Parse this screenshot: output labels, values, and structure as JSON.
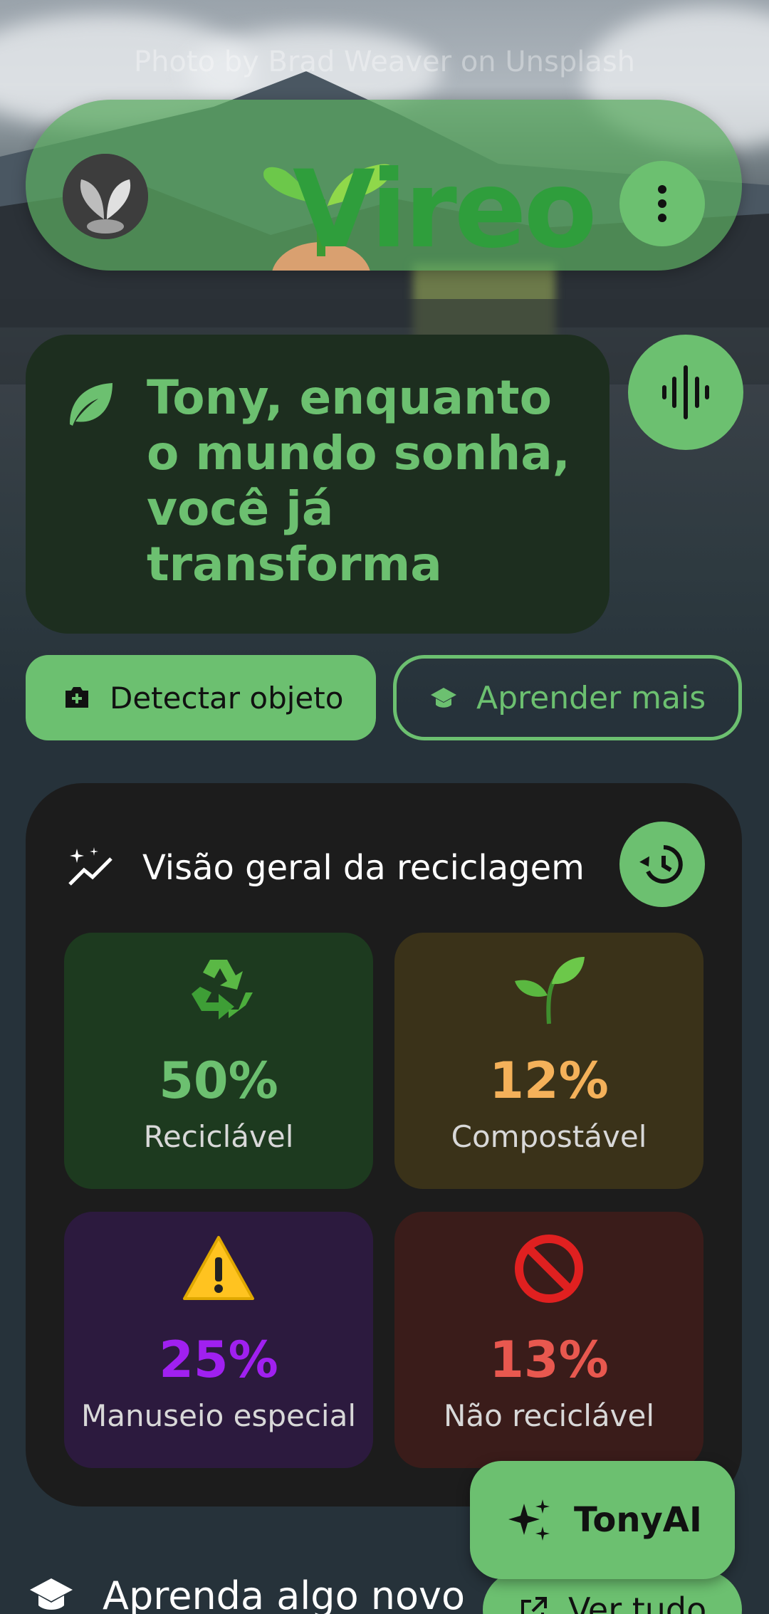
{
  "background": {
    "credit": "Photo by Brad Weaver on Unsplash"
  },
  "topbar": {
    "logo_text": "Vireo",
    "avatar_icon": "sprout-avatar-icon",
    "menu_icon": "more-vert-icon"
  },
  "greeting": {
    "icon": "leaf-icon",
    "text": "Tony, enquanto o mundo sonha, você já transforma",
    "voice_icon": "voice-wave-icon"
  },
  "actions": {
    "detect_label": "Detectar objeto",
    "detect_icon": "camera-add-icon",
    "learn_label": "Aprender mais",
    "learn_icon": "graduation-cap-icon"
  },
  "overview": {
    "title": "Visão geral da reciclagem",
    "title_icon": "sparkle-trend-icon",
    "history_icon": "history-icon",
    "stats": [
      {
        "pct": "50%",
        "label": "Reciclável",
        "emoji": "recycle-emoji",
        "color": "#6cc070"
      },
      {
        "pct": "12%",
        "label": "Compostável",
        "emoji": "seedling-emoji",
        "color": "#f4b15a"
      },
      {
        "pct": "25%",
        "label": "Manuseio especial",
        "emoji": "warning-emoji",
        "color": "#a020f0"
      },
      {
        "pct": "13%",
        "label": "Não reciclável",
        "emoji": "prohibited-emoji",
        "color": "#e8584f"
      }
    ]
  },
  "fab": {
    "label": "TonyAI",
    "icon": "sparkles-icon"
  },
  "learn_section": {
    "title": "Aprenda algo novo",
    "icon": "graduation-cap-icon",
    "see_all_label": "Ver tudo",
    "see_all_icon": "open-external-icon"
  },
  "colors": {
    "accent": "#6cc070",
    "card_dark": "#1c1c1c",
    "greeting_bg": "#1d2e1f"
  }
}
